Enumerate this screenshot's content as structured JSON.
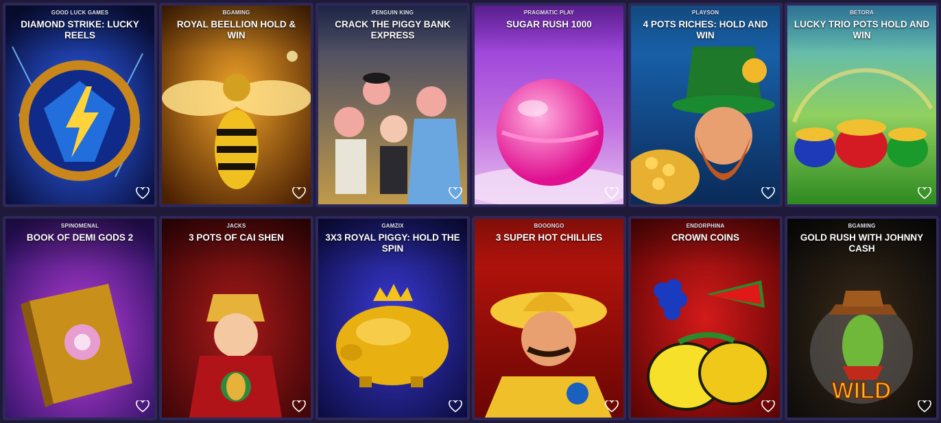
{
  "games": [
    {
      "provider": "GOOD LUCK GAMES",
      "title": "DIAMOND STRIKE: LUCKY REELS",
      "bg": [
        "#0b1e6e",
        "#1b0d4a"
      ],
      "accent": "#f2b41c"
    },
    {
      "provider": "BGAMING",
      "title": "ROYAL BEELLION HOLD & WIN",
      "bg": [
        "#b86a0c",
        "#3d1a02"
      ],
      "accent": "#ffd23a"
    },
    {
      "provider": "PENGUIN KING",
      "title": "CRACK THE PIGGY BANK EXPRESS",
      "bg": [
        "#39456e",
        "#b08a3c"
      ],
      "accent": "#e8a6a0"
    },
    {
      "provider": "PRAGMATIC PLAY",
      "title": "SUGAR RUSH 1000",
      "bg": [
        "#8a2bd6",
        "#c890e8"
      ],
      "accent": "#ff4fb4"
    },
    {
      "provider": "PLAYSON",
      "title": "4 POTS RICHES: HOLD AND WIN",
      "bg": [
        "#1a5ea8",
        "#0e2e5c"
      ],
      "accent": "#1f8a2a"
    },
    {
      "provider": "BETORA",
      "title": "LUCKY TRIO POTS HOLD AND WIN",
      "bg": [
        "#3aa0c8",
        "#3f9a2e"
      ],
      "accent": "#e0202a"
    },
    {
      "provider": "SPINOMENAL",
      "title": "BOOK OF DEMI GODS 2",
      "bg": [
        "#3d1a7a",
        "#a02ec8"
      ],
      "accent": "#e0a52a"
    },
    {
      "provider": "JACKS",
      "title": "3 POTS OF CAI SHEN",
      "bg": [
        "#7a0c10",
        "#3a0408"
      ],
      "accent": "#e6b23a"
    },
    {
      "provider": "GAMZIX",
      "title": "3X3 ROYAL PIGGY: HOLD THE SPIN",
      "bg": [
        "#2a2aa0",
        "#0d0d48"
      ],
      "accent": "#f4c21a"
    },
    {
      "provider": "BOOONGO",
      "title": "3 SUPER HOT CHILLIES",
      "bg": [
        "#b0140e",
        "#5a0604"
      ],
      "accent": "#f4c836"
    },
    {
      "provider": "ENDORPHINA",
      "title": "CROWN COINS",
      "bg": [
        "#b81010",
        "#5a0404"
      ],
      "accent": "#f6e02a"
    },
    {
      "provider": "BGAMING",
      "title": "GOLD RUSH WITH JOHNNY CASH",
      "bg": [
        "#2a2418",
        "#0d0d0d"
      ],
      "accent": "#6fb83a"
    }
  ],
  "icons": {
    "favorite": "heart-outline-icon"
  },
  "colors": {
    "page_bg": "#1f1a3a",
    "card_border": "#2e2858",
    "text": "#ffffff"
  }
}
